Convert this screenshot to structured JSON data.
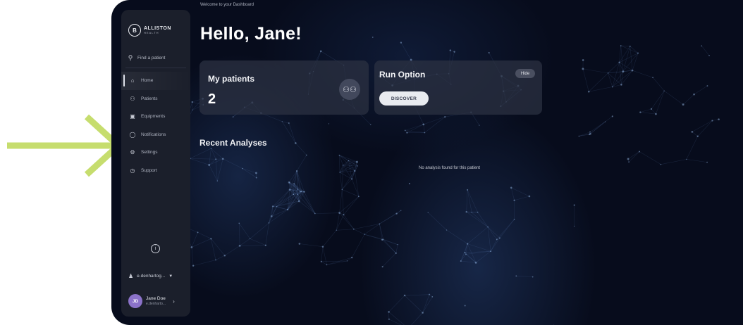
{
  "colors": {
    "annotation_arrow": "#c6dd6e",
    "background": "#070c1c",
    "sidebar": "#1b1f2b",
    "card": "#2c3242",
    "avatar": "#8b72c9",
    "discover_button": "#e9ebf0"
  },
  "sidebar": {
    "logo": {
      "mark": "B",
      "name": "ALLISTON",
      "subtitle": "HEALTH"
    },
    "search": {
      "icon": "search-icon",
      "label": "Find a patient"
    },
    "items": [
      {
        "icon": "home-icon",
        "label": "Home",
        "active": true
      },
      {
        "icon": "patients-icon",
        "label": "Patients",
        "active": false
      },
      {
        "icon": "equipment-icon",
        "label": "Equipments",
        "active": false
      },
      {
        "icon": "bell-icon",
        "label": "Notifications",
        "active": false
      },
      {
        "icon": "gear-icon",
        "label": "Settings",
        "active": false
      },
      {
        "icon": "clock-icon",
        "label": "Support",
        "active": false
      }
    ],
    "info_icon": "info-icon",
    "account": {
      "icon": "user-icon",
      "label": "e.denhartog...",
      "chevron": "chevron-down-icon"
    },
    "user": {
      "initials": "JD",
      "name": "Jane Doe",
      "email": "e.denharto...",
      "chevron": "chevron-right-icon"
    }
  },
  "main": {
    "welcome": "Welcome to your Dashboard",
    "greeting": "Hello, Jane!",
    "patients_card": {
      "title": "My patients",
      "count": "2",
      "icon": "patients-group-icon"
    },
    "run_card": {
      "title": "Run Option",
      "hide_label": "Hide",
      "button_label": "DISCOVER"
    },
    "recent_title": "Recent Analyses",
    "empty_message": "No analysis found for this patient"
  }
}
